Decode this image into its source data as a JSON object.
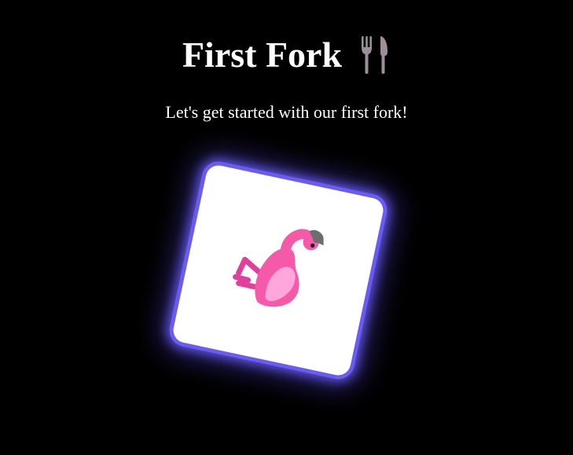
{
  "header": {
    "title": "First Fork",
    "title_icon": "fork-and-knife-icon",
    "subtitle": "Let's get started with our first fork!"
  },
  "card": {
    "image_icon": "flamingo-icon",
    "glow_color": "#6a5cf0"
  },
  "colors": {
    "background": "#000000",
    "text": "#ffffff",
    "flamingo_pink": "#f45aa8",
    "flamingo_light": "#ffa6dd",
    "flamingo_legs": "#e0409c",
    "beak_gray": "#6d6d6d"
  }
}
